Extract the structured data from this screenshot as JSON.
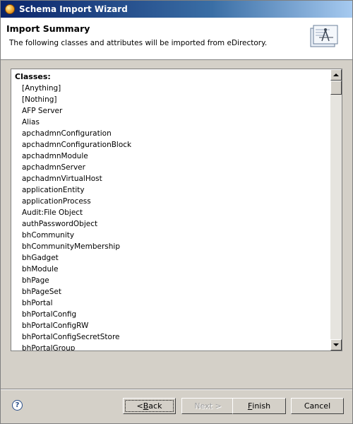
{
  "window": {
    "title": "Schema Import Wizard"
  },
  "header": {
    "title": "Import Summary",
    "description": "The following classes and attributes will be imported from eDirectory."
  },
  "list": {
    "heading": "Classes:",
    "items": [
      "[Anything]",
      "[Nothing]",
      "AFP Server",
      "Alias",
      "apchadmnConfiguration",
      "apchadmnConfigurationBlock",
      "apchadmnModule",
      "apchadmnServer",
      "apchadmnVirtualHost",
      "applicationEntity",
      "applicationProcess",
      "Audit:File Object",
      "authPasswordObject",
      "bhCommunity",
      "bhCommunityMembership",
      "bhGadget",
      "bhModule",
      "bhPage",
      "bhPageSet",
      "bhPortal",
      "bhPortalConfig",
      "bhPortalConfigRW",
      "bhPortalConfigSecretStore",
      "bhPortalGroup"
    ]
  },
  "buttons": {
    "back": {
      "mnemonic": "<",
      "pre": " ",
      "underline": "B",
      "rest": "ack"
    },
    "next": "Next >",
    "finish": {
      "underline": "F",
      "rest": "inish"
    },
    "cancel": "Cancel"
  },
  "icons": {
    "window": "app-icon",
    "header": "schema-wizard-icon",
    "help": "help-icon"
  },
  "colors": {
    "titlebar_start": "#0a246a",
    "titlebar_end": "#a6caf0",
    "dialog_bg": "#d4d0c8"
  }
}
